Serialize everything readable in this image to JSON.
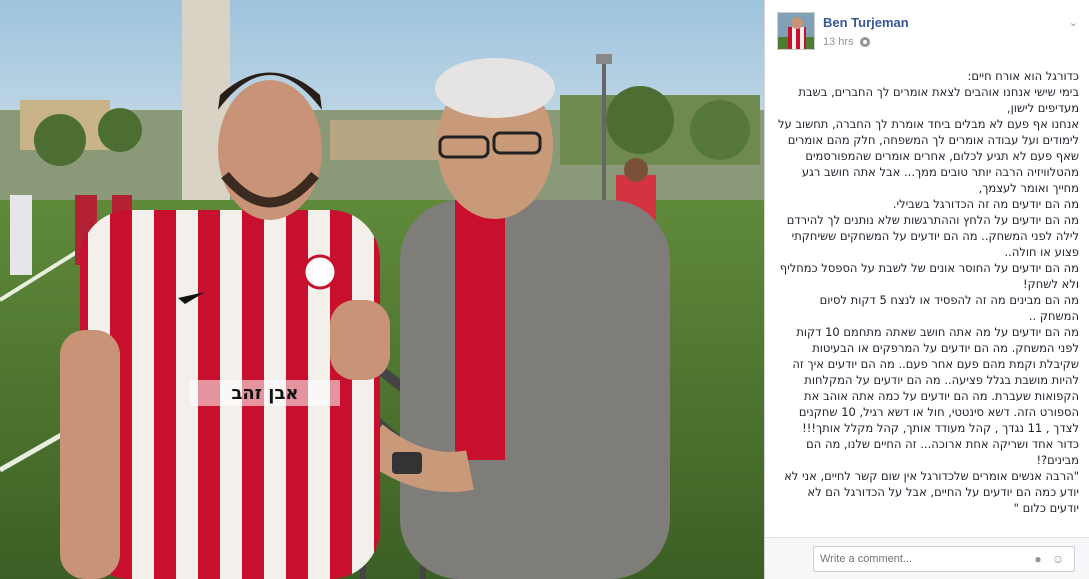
{
  "post": {
    "author": "Ben Turjeman",
    "timestamp": "13 hrs",
    "privacy_icon": "globe-icon",
    "options_icon": "chevron-down-icon",
    "body": "כדורגל הוא אורח חיים:\nבימי שישי אנחנו אוהבים לצאת אומרים לך החברים, בשבת מעדיפים לישון,\nאנחנו אף פעם לא מבלים ביחד אומרת לך החברה, תחשוב על לימודים ועל עבודה אומרים לך המשפחה, חלק מהם אומרים שאף פעם לא תגיע לכלום, אחרים אומרים שהמפורסמים מהטלוויזיה הרבה יותר טובים ממך... אבל אתה חושב רגע מחייך ואומר לעצמך,\nמה הם יודעים מה זה הכדורגל בשבילי.\nמה הם יודעים על הלחץ וההתרגשות שלא נותנים לך להירדם לילה לפני המשחק.. מה הם יודעים על המשחקים ששיחקתי פצוע או חולה..\nמה הם יודעים על החוסר אונים של לשבת על הספסל כמחליף ולא לשחק!\nמה הם מבינים מה זה להפסיד או לנצח 5 דקות לסיום המשחק ..\nמה הם יודעים על מה אתה חושב שאתה מתחמם 10 דקות לפני המשחק. מה הם יודעים על המרפקים או הבעיטות שקיבלת וקמת מהם פעם אחר פעם.. מה הם יודעים איך זה להיות מושבת בגלל פציעה.. מה הם יודעים על המקלחות הקפואות שעברת. מה הם יודעים על כמה אתה אוהב את הספורט הזה. דשא סינטטי, חול או דשא רגיל, 10 שחקנים לצדך , 11 נגדך , קהל מעודד אותך, קהל מקלל אותך!!! כדור אחד ושריקה אחת ארוכה... זה החיים שלנו, מה הם מבינים?!\n\"הרבה אנשים אומרים שלכדורגל אין שום קשר לחיים, אני לא יודע כמה הם יודעים על החיים, אבל על הכדורגל הם לא יודעים כלום \""
  },
  "comment": {
    "placeholder": "Write a comment...",
    "camera_icon": "camera-icon",
    "emoji_icon": "emoji-icon"
  },
  "photo": {
    "description_icon": "photo",
    "jersey_sponsor": "אבן זהב"
  },
  "colors": {
    "link_blue": "#365899",
    "meta_grey": "#90949c",
    "text": "#1d2129",
    "jersey_red": "#c8102e"
  }
}
